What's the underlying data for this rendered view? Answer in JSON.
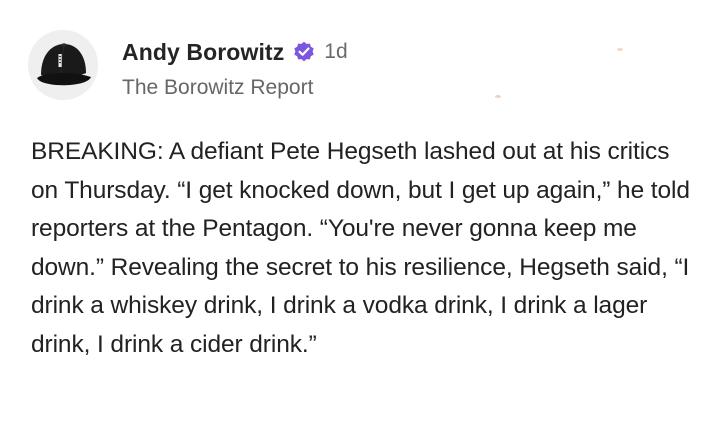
{
  "post": {
    "author": {
      "name": "Andy Borowitz",
      "verified_icon": "verified-badge-icon",
      "avatar_icon": "black-cap-avatar-icon"
    },
    "time": "1d",
    "publication": "The Borowitz Report",
    "body": "BREAKING: A defiant Pete Hegseth lashed out at his critics on Thursday. “I get knocked down, but I get up again,” he told reporters at the Pentagon. “You're never gonna keep me down.” Revealing the secret to his resilience, Hegseth said, “I drink a whiskey drink, I drink a vodka drink, I drink a lager drink, I drink a cider drink.”"
  },
  "colors": {
    "verified_badge": "#7b57e0",
    "text_primary": "#222222",
    "text_secondary": "#666666"
  }
}
